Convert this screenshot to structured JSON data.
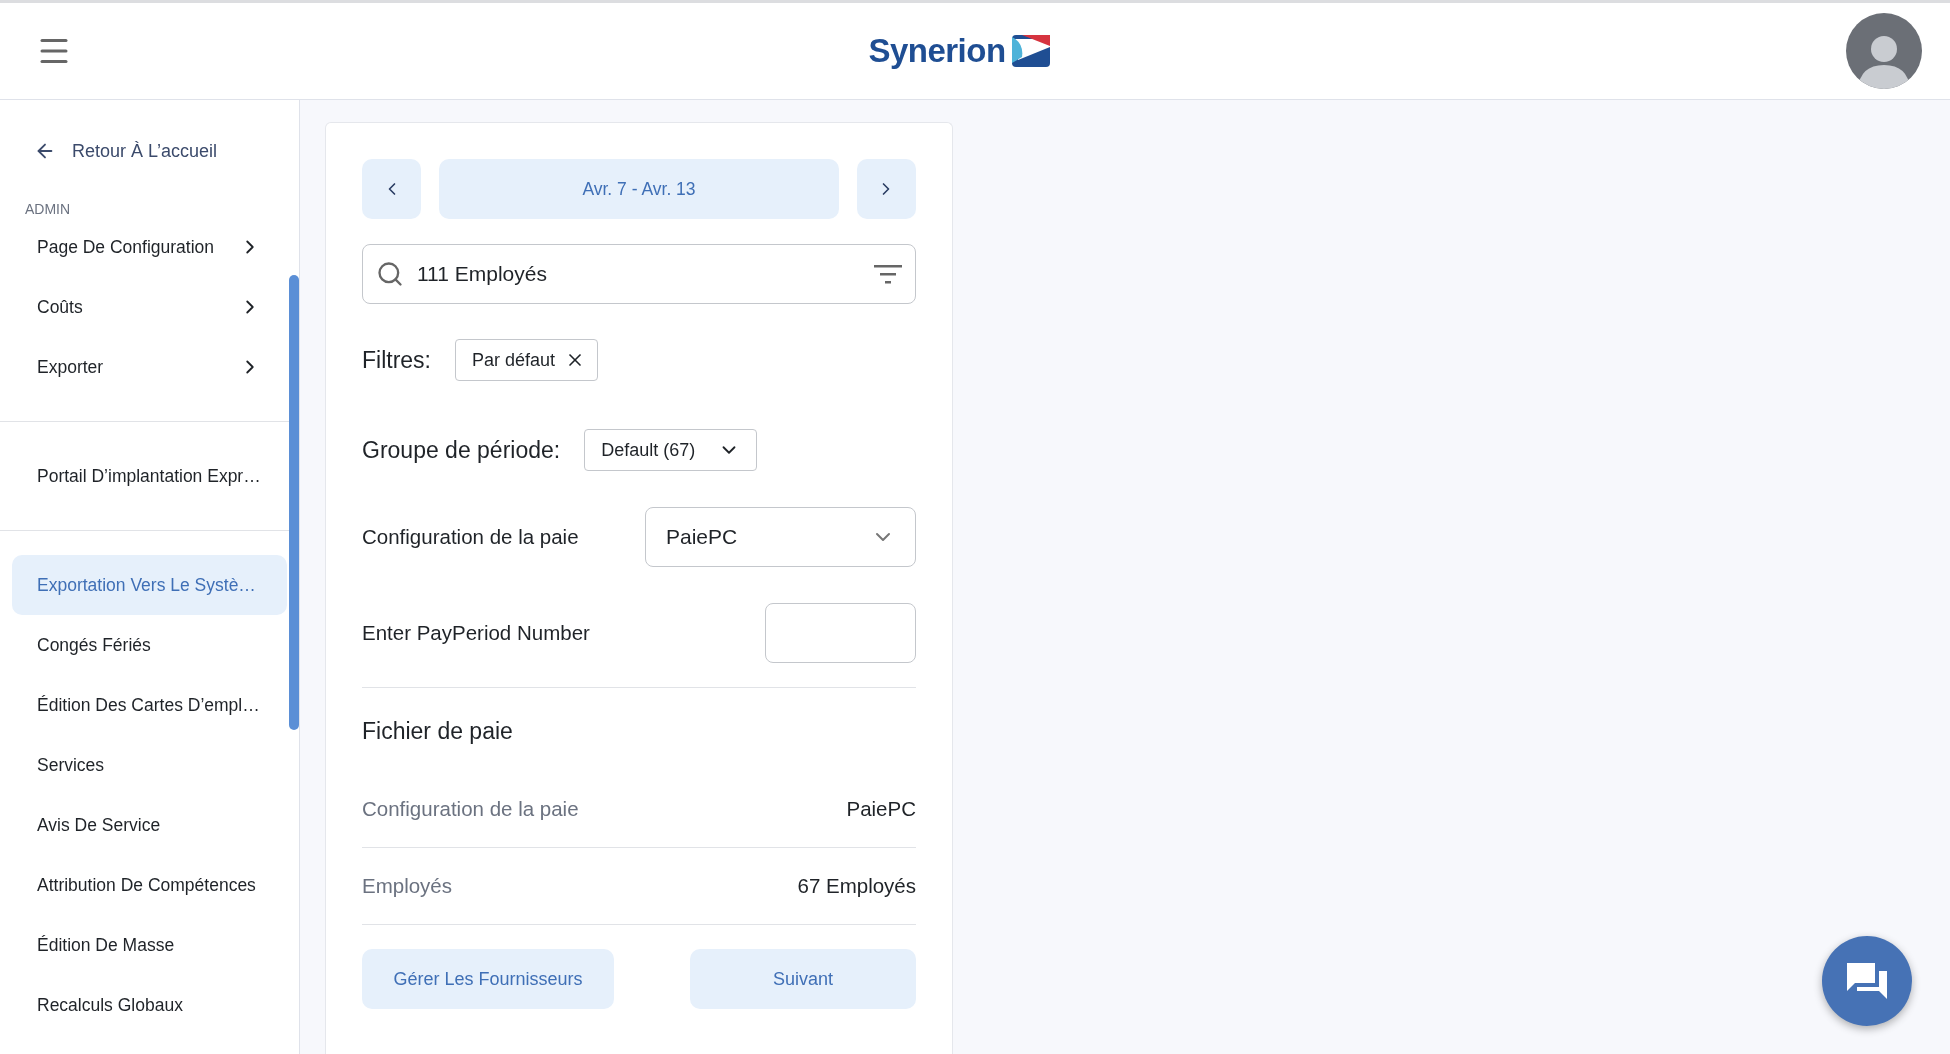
{
  "header": {
    "logo_text": "Synerion"
  },
  "sidebar": {
    "back_link": "Retour À L’accueil",
    "section_label": "ADMIN",
    "groups": [
      [
        {
          "label": "Page De Configuration",
          "kind": "submenu",
          "selected": false
        },
        {
          "label": "Coûts",
          "kind": "submenu",
          "selected": false
        },
        {
          "label": "Exporter",
          "kind": "submenu",
          "selected": false
        }
      ],
      [
        {
          "label": "Portail D’implantation Expr…",
          "kind": "link",
          "selected": false
        }
      ],
      [
        {
          "label": "Exportation Vers Le Systè…",
          "kind": "link",
          "selected": true
        },
        {
          "label": "Congés Fériés",
          "kind": "link",
          "selected": false
        },
        {
          "label": "Édition Des Cartes D’empl…",
          "kind": "link",
          "selected": false
        },
        {
          "label": "Services",
          "kind": "link",
          "selected": false
        },
        {
          "label": "Avis De Service",
          "kind": "link",
          "selected": false
        },
        {
          "label": "Attribution De Compétences",
          "kind": "link",
          "selected": false
        },
        {
          "label": "Édition De Masse",
          "kind": "link",
          "selected": false
        },
        {
          "label": "Recalculs Globaux",
          "kind": "link",
          "selected": false
        }
      ]
    ]
  },
  "panel": {
    "date_range": "Avr. 7 - Avr. 13",
    "search": {
      "value": "111 Employés"
    },
    "filters": {
      "label": "Filtres:",
      "chips": [
        "Par défaut"
      ]
    },
    "period_group": {
      "label": "Groupe de période:",
      "value": "Default (67)"
    },
    "pay_config": {
      "label": "Configuration de la paie",
      "value": "PaiePC"
    },
    "pay_period": {
      "label": "Enter PayPeriod Number"
    },
    "pay_file": {
      "title": "Fichier de paie",
      "rows": [
        {
          "label": "Configuration de la paie",
          "value": "PaiePC"
        },
        {
          "label": "Employés",
          "value": "67 Employés"
        }
      ]
    },
    "buttons": [
      "Gérer Les Fournisseurs",
      "Suivant"
    ]
  }
}
